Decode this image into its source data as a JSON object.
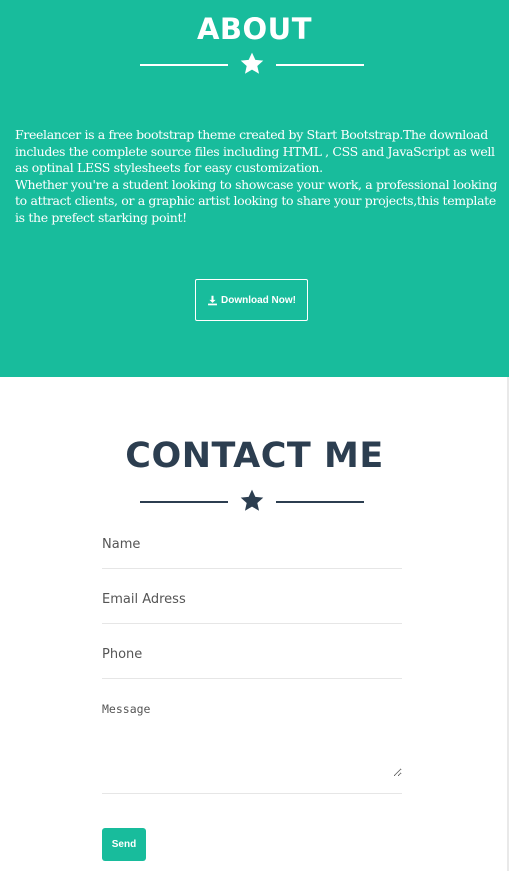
{
  "about": {
    "title": "ABOUT",
    "paragraph1": "Freelancer is a free bootstrap theme created by Start Bootstrap.The download includes the complete source files including HTML , CSS and JavaScript as well as optinal LESS stylesheets for easy customization.",
    "paragraph2": "Whether you're a student looking to showcase your work, a professional looking to attract clients, or a graphic artist looking to share your projects,this template is the prefect starking point!",
    "download_label": "Download Now!",
    "background_color": "#18bc9c"
  },
  "contact": {
    "title": "CONTACT ME",
    "name_placeholder": "Name",
    "email_placeholder": "Email Adress",
    "phone_placeholder": "Phone",
    "message_placeholder": "Message",
    "send_label": "Send",
    "title_color": "#2c3e50",
    "accent_color": "#18bc9c"
  },
  "icons": {
    "divider_icon": "star-icon",
    "download_icon": "download-icon"
  }
}
